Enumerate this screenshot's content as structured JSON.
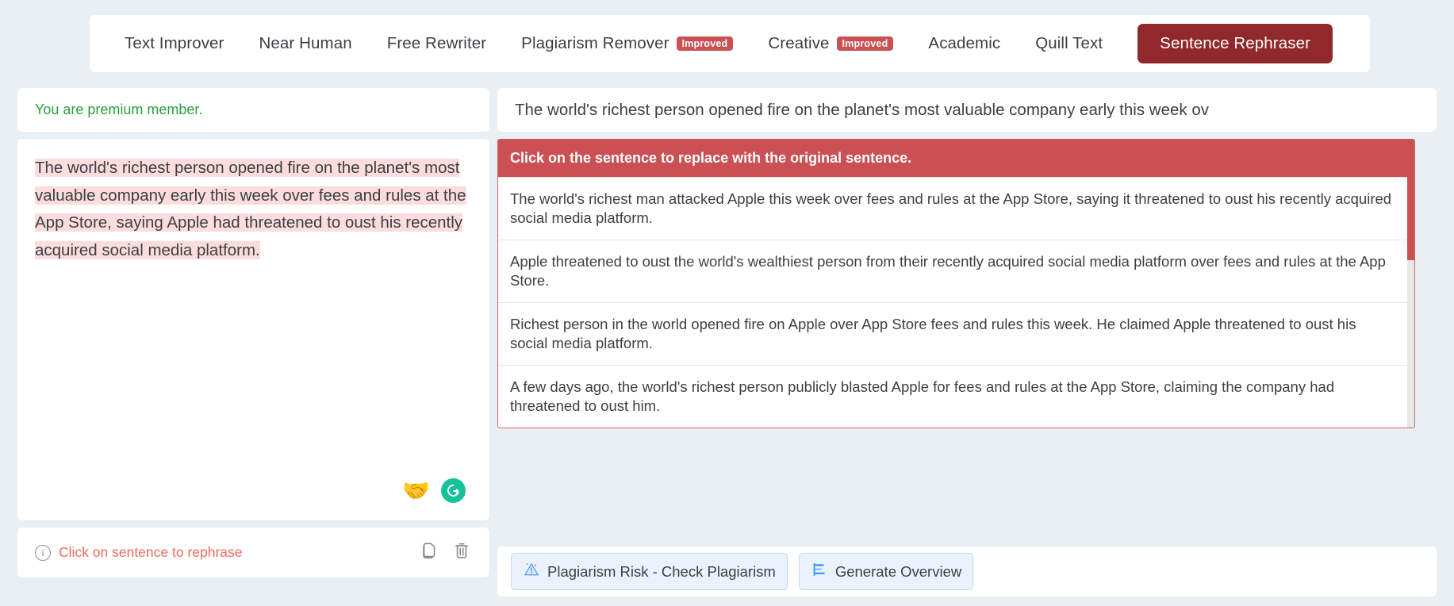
{
  "tabs": [
    {
      "label": "Text Improver",
      "badge": null,
      "active": false
    },
    {
      "label": "Near Human",
      "badge": null,
      "active": false
    },
    {
      "label": "Free Rewriter",
      "badge": null,
      "active": false
    },
    {
      "label": "Plagiarism Remover",
      "badge": "Improved",
      "active": false
    },
    {
      "label": "Creative",
      "badge": "Improved",
      "active": false
    },
    {
      "label": "Academic",
      "badge": null,
      "active": false
    },
    {
      "label": "Quill Text",
      "badge": null,
      "active": false
    },
    {
      "label": "Sentence Rephraser",
      "badge": null,
      "active": true
    }
  ],
  "left": {
    "premium_notice": "You are premium member.",
    "editor_text": "The world's richest person opened fire on the planet's most valuable company early this week over fees and rules at the App Store, saying Apple had threatened to oust his recently acquired social media platform.",
    "handshake_icon": "🤝",
    "grammarly_icon": "G",
    "footer": {
      "info_icon": "i",
      "hint": "Click on sentence to rephrase",
      "copy_icon": "copy-icon",
      "delete_icon": "trash-icon"
    }
  },
  "right": {
    "output_preview": "The world's richest person opened fire on the planet's most valuable company early this week ov",
    "suggestions_header": "Click on the sentence to replace with the original sentence.",
    "suggestions": [
      "The world's richest man attacked Apple this week over fees and rules at the App Store, saying it threatened to oust his recently acquired social media platform.",
      "Apple threatened to oust the world's wealthiest person from their recently acquired social media platform over fees and rules at the App Store.",
      "Richest person in the world opened fire on Apple over App Store fees and rules this week. He claimed Apple threatened to oust his social media platform.",
      "A few days ago, the world's richest person publicly blasted Apple for fees and rules at the App Store, claiming the company had threatened to oust him."
    ],
    "footer": {
      "plagiarism_label": "Plagiarism Risk - Check Plagiarism",
      "plagiarism_icon": "warning-triangle-icon",
      "overview_label": "Generate Overview",
      "overview_icon": "list-lines-icon"
    }
  },
  "colors": {
    "page_bg": "#eaeff3",
    "active_tab": "#91282c",
    "badge": "#cb5054",
    "suggestion_header": "#cb5054",
    "highlight": "#fcdcdc",
    "premium_green": "#2aa03c",
    "hint_red": "#ef6b5c",
    "pill_bg": "#eaf3fd"
  }
}
